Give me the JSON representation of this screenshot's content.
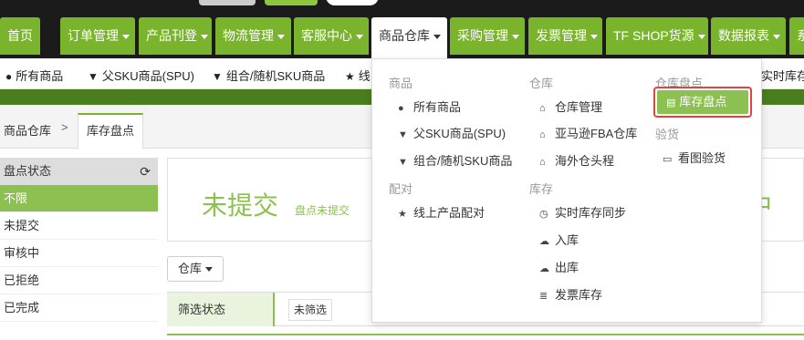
{
  "nav": {
    "items": [
      {
        "label": "首页",
        "caret": false
      },
      {
        "label": "订单管理",
        "caret": true
      },
      {
        "label": "产品刊登",
        "caret": true
      },
      {
        "label": "物流管理",
        "caret": true
      },
      {
        "label": "客服中心",
        "caret": true
      },
      {
        "label": "商品仓库",
        "caret": true
      },
      {
        "label": "采购管理",
        "caret": true
      },
      {
        "label": "发票管理",
        "caret": true
      },
      {
        "label": "TF SHOP货源",
        "caret": true
      },
      {
        "label": "数据报表",
        "caret": true
      },
      {
        "label": "系",
        "caret": false
      }
    ]
  },
  "subnav": {
    "items": [
      {
        "icon": "●",
        "label": "所有商品"
      },
      {
        "icon": "▼",
        "label": "父SKU商品(SPU)"
      },
      {
        "icon": "▼",
        "label": "组合/随机SKU商品"
      },
      {
        "icon": "★",
        "label": "线"
      },
      {
        "icon": "",
        "label": "实时库存"
      }
    ]
  },
  "breadcrumb": {
    "root": "商品仓库",
    "sep": ">",
    "tab": "库存盘点"
  },
  "left_panel": {
    "header": "盘点状态",
    "items": [
      "不限",
      "未提交",
      "审核中",
      "已拒绝",
      "已完成"
    ],
    "active_index": 0
  },
  "status_box": {
    "big": "未提交",
    "small": "盘点未提交",
    "right_big": "中"
  },
  "warehouse_button": "仓库",
  "filter": {
    "label": "筛选状态",
    "value": "未筛选"
  },
  "dropdown": {
    "col1": {
      "head_goods": "商品",
      "goods_items": [
        {
          "icon": "●",
          "label": "所有商品"
        },
        {
          "icon": "▼",
          "label": "父SKU商品(SPU)"
        },
        {
          "icon": "▼",
          "label": "组合/随机SKU商品"
        }
      ],
      "head_match": "配对",
      "match_items": [
        {
          "icon": "★",
          "label": "线上产品配对"
        }
      ]
    },
    "col2": {
      "head_wh": "仓库",
      "wh_items": [
        {
          "icon": "⌂",
          "label": "仓库管理"
        },
        {
          "icon": "⌂",
          "label": "亚马逊FBA仓库"
        },
        {
          "icon": "⌂",
          "label": "海外仓头程"
        }
      ],
      "head_stock": "库存",
      "stock_items": [
        {
          "icon": "◷",
          "label": "实时库存同步"
        },
        {
          "icon": "☁",
          "label": "入库"
        },
        {
          "icon": "☁",
          "label": "出库"
        },
        {
          "icon": "≣",
          "label": "发票库存"
        }
      ]
    },
    "col3": {
      "head_count": "仓库盘点",
      "count_item": {
        "icon": "▤",
        "label": "库存盘点"
      },
      "head_check": "验货",
      "check_item": {
        "icon": "▭",
        "label": "看图验货"
      }
    }
  },
  "colors": {
    "nav_green": "#79b42c",
    "accent_green": "#8cc152",
    "highlight_red": "#e0443a"
  }
}
